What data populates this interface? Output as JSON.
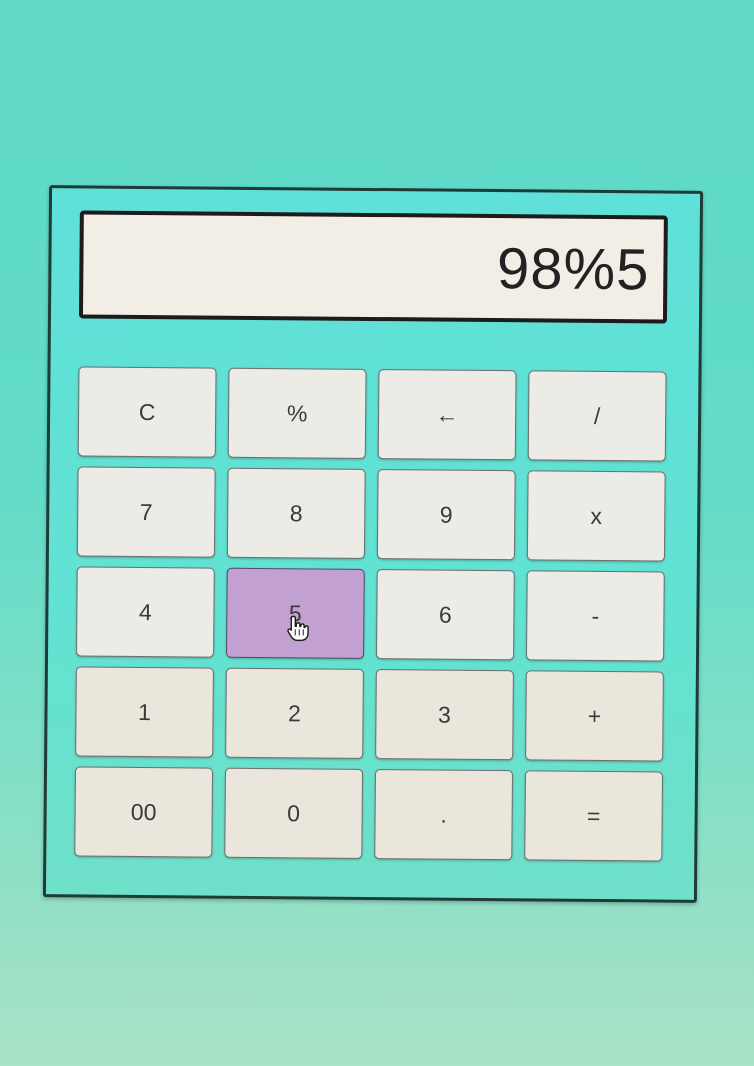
{
  "display": {
    "value": "98%5"
  },
  "keypad": {
    "keys": [
      {
        "label": "C",
        "name": "clear-button"
      },
      {
        "label": "%",
        "name": "modulo-button"
      },
      {
        "label": "←",
        "name": "backspace-button"
      },
      {
        "label": "/",
        "name": "divide-button"
      },
      {
        "label": "7",
        "name": "digit-7-button"
      },
      {
        "label": "8",
        "name": "digit-8-button"
      },
      {
        "label": "9",
        "name": "digit-9-button"
      },
      {
        "label": "x",
        "name": "multiply-button"
      },
      {
        "label": "4",
        "name": "digit-4-button"
      },
      {
        "label": "5",
        "name": "digit-5-button"
      },
      {
        "label": "6",
        "name": "digit-6-button"
      },
      {
        "label": "-",
        "name": "subtract-button"
      },
      {
        "label": "1",
        "name": "digit-1-button"
      },
      {
        "label": "2",
        "name": "digit-2-button"
      },
      {
        "label": "3",
        "name": "digit-3-button"
      },
      {
        "label": "+",
        "name": "add-button"
      },
      {
        "label": "00",
        "name": "double-zero-button"
      },
      {
        "label": "0",
        "name": "digit-0-button"
      },
      {
        "label": ".",
        "name": "decimal-button"
      },
      {
        "label": "=",
        "name": "equals-button"
      }
    ],
    "active_key": "5"
  },
  "colors": {
    "page_background": "#62dcc9",
    "calculator_body": "#5fe0d8",
    "display_background": "#f2eee6",
    "key_background": "#ecebe6",
    "active_key_background": "#c3a0d2"
  },
  "cursor_icon": "hand-pointer-icon"
}
